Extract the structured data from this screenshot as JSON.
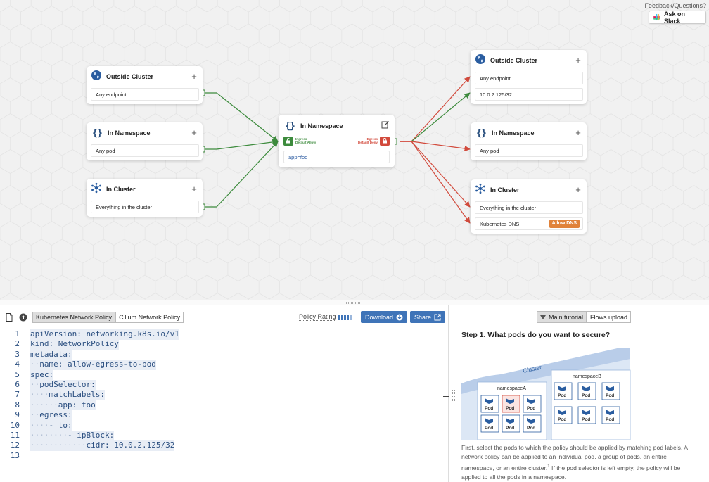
{
  "header": {
    "feedback": "Feedback/Questions?",
    "slack_button": "Ask on Slack"
  },
  "colors": {
    "allow": "#3d8b3d",
    "deny": "#d24a3c",
    "accent": "#3f74b8",
    "dns_badge": "#e0823a"
  },
  "ingress": {
    "cards": [
      {
        "title": "Outside Cluster",
        "icon": "globe-icon",
        "rows": [
          "Any endpoint"
        ]
      },
      {
        "title": "In Namespace",
        "icon": "braces-icon",
        "rows": [
          "Any pod"
        ]
      },
      {
        "title": "In Cluster",
        "icon": "cluster-icon",
        "rows": [
          "Everything in the cluster"
        ]
      }
    ]
  },
  "center": {
    "title": "In Namespace",
    "ingress_label_1": "Ingress",
    "ingress_label_2": "Default Allow",
    "egress_label_1": "Egress",
    "egress_label_2": "Default Deny",
    "selector": "app=foo"
  },
  "egress": {
    "cards": [
      {
        "title": "Outside Cluster",
        "icon": "globe-icon",
        "rows": [
          "Any endpoint",
          "10.0.2.125/32"
        ]
      },
      {
        "title": "In Namespace",
        "icon": "braces-icon",
        "rows": [
          "Any pod"
        ]
      },
      {
        "title": "In Cluster",
        "icon": "cluster-icon",
        "rows": [
          "Everything in the cluster",
          "Kubernetes DNS"
        ],
        "badge": "Allow DNS"
      }
    ]
  },
  "editor": {
    "tabs": [
      "Kubernetes Network Policy",
      "Cilium Network Policy"
    ],
    "active_tab": "Kubernetes Network Policy",
    "policy_rating_label": "Policy Rating",
    "policy_rating": 0.8,
    "download_label": "Download",
    "share_label": "Share",
    "code_lines": [
      "apiVersion: networking.k8s.io/v1",
      "kind: NetworkPolicy",
      "metadata:",
      "  name: allow-egress-to-pod",
      "spec:",
      "  podSelector:",
      "    matchLabels:",
      "      app: foo",
      "  egress:",
      "    - to:",
      "        - ipBlock:",
      "            cidr: 10.0.2.125/32",
      ""
    ]
  },
  "tutorial": {
    "tabs": [
      "Main tutorial",
      "Flows upload"
    ],
    "active_tab": "Main tutorial",
    "step_title": "Step 1. What pods do you want to secure?",
    "illustration": {
      "cluster_label": "Cluster",
      "namespace_a": "namespaceA",
      "namespace_b": "namespaceB",
      "pod_label": "Pod"
    },
    "text_1": "First, select the pods to which the policy should be applied by matching pod labels. A network policy can be applied to an individual pod, a group of pods, an entire namespace, or an entire cluster.",
    "footnote": "1",
    "text_2": " If the pod selector is left empty, the policy will be applied to all the pods in a namespace."
  }
}
